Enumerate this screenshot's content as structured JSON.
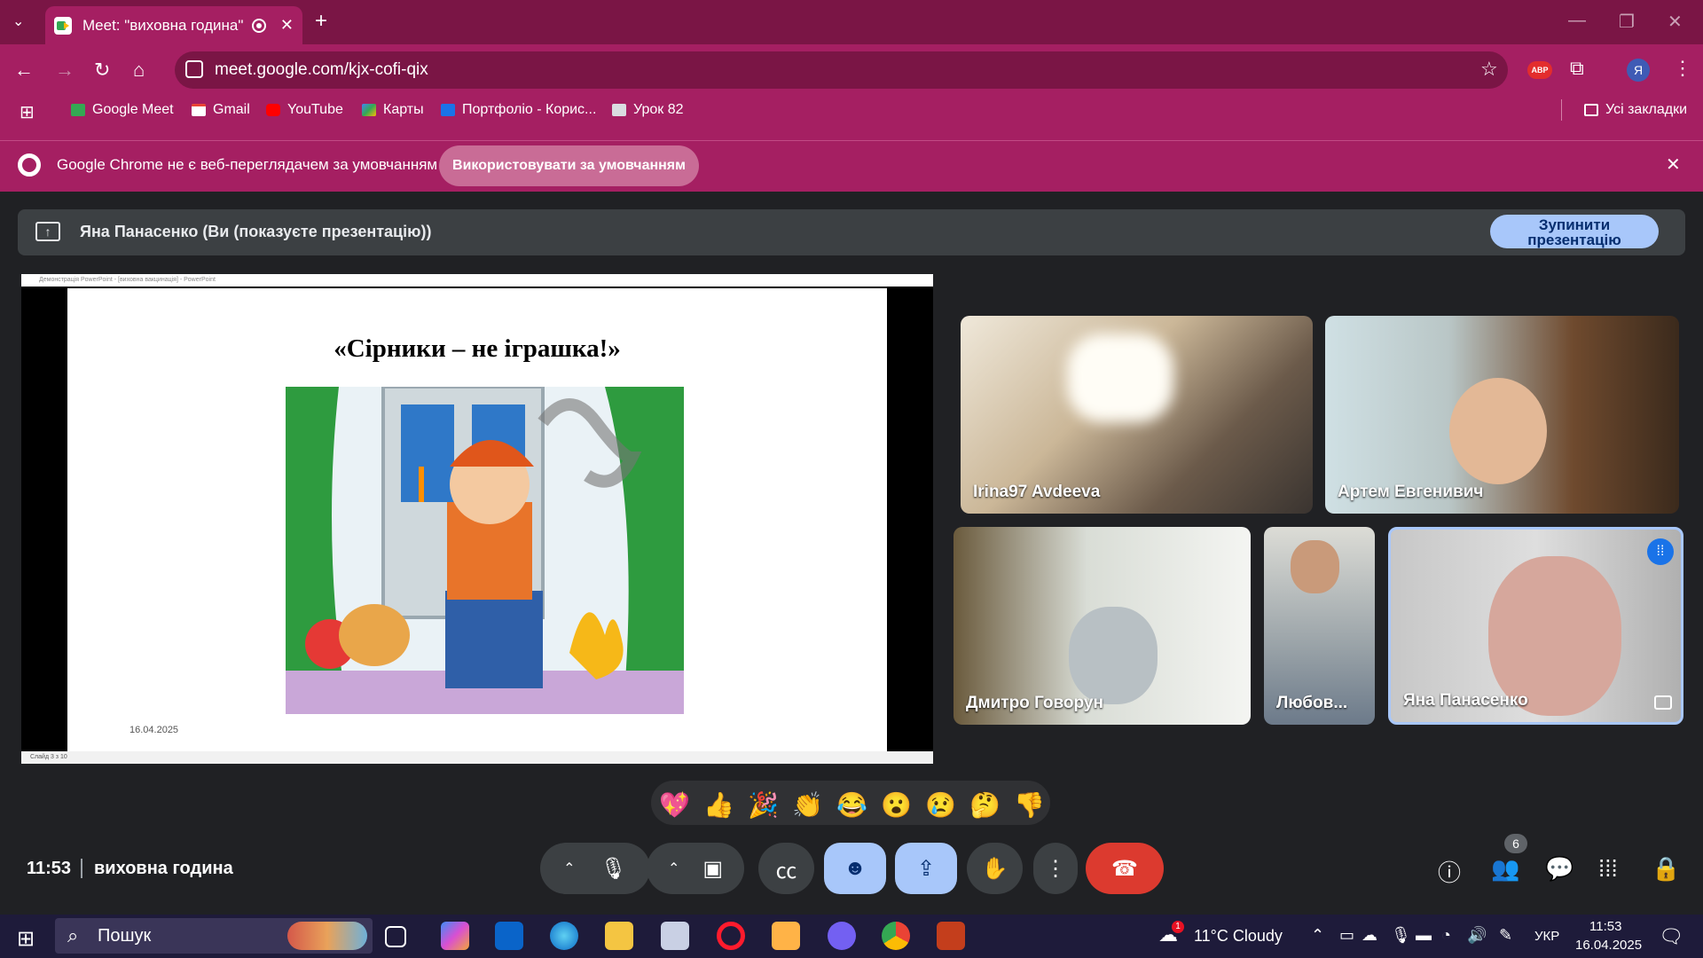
{
  "browser": {
    "tab_title": "Meet: \"виховна година\"",
    "url": "meet.google.com/kjx-cofi-qix",
    "profile_initial": "Я",
    "bookmarks": [
      "Google Meet",
      "Gmail",
      "YouTube",
      "Карты",
      "Портфоліо - Корис...",
      "Урок 82"
    ],
    "all_bookmarks": "Усі закладки",
    "infobar_message": "Google Chrome не є веб-переглядачем за умовчанням",
    "infobar_button": "Використовувати за умовчанням"
  },
  "meet": {
    "presenting_text": "Яна Панасенко (Ви (показуєте презентацію))",
    "stop_button": "Зупинити презентацію",
    "slide": {
      "window_title": "Демонстрація PowerPoint - [виховна вакцинація] - PowerPoint",
      "title": "«Сірники – не іграшка!»",
      "date": "16.04.2025",
      "status": "Слайд 3 з 10"
    },
    "participants": [
      "Irina97 Avdeeva",
      "Артем Евгенивич",
      "Дмитро Говорун",
      "Любов...",
      "Яна Панасенко"
    ],
    "reactions": [
      "💖",
      "👍",
      "🎉",
      "👏",
      "😂",
      "😮",
      "😢",
      "🤔",
      "👎"
    ],
    "time": "11:53",
    "meeting_name": "виховна година",
    "people_count": "6"
  },
  "taskbar": {
    "search_placeholder": "Пошук",
    "weather": "11°C  Cloudy",
    "language": "УКР",
    "time": "11:53",
    "date": "16.04.2025",
    "weather_badge": "1"
  }
}
